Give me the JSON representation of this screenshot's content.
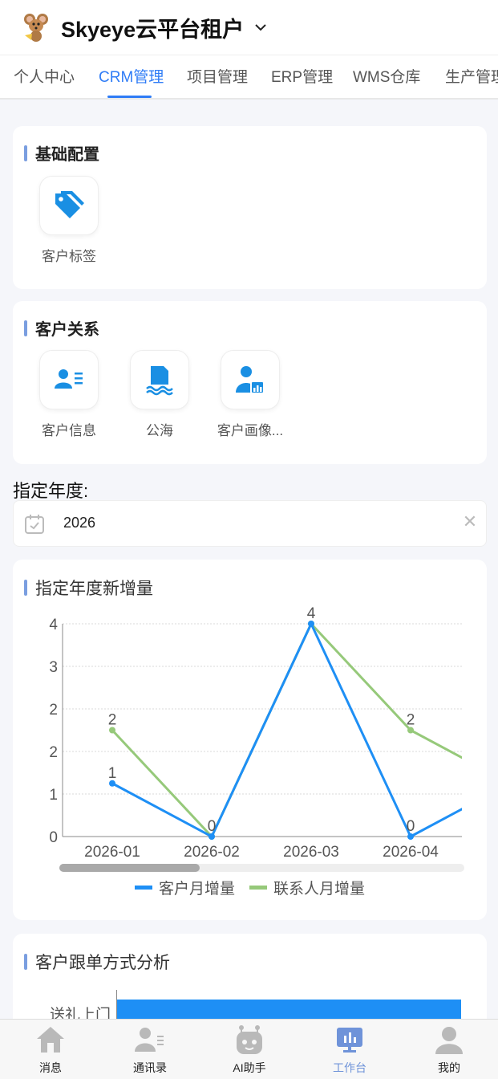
{
  "header": {
    "title": "Skyeye云平台租户"
  },
  "tabs": [
    "个人中心",
    "CRM管理",
    "项目管理",
    "ERP管理",
    "WMS仓库",
    "生产管理"
  ],
  "sections": {
    "basic": {
      "title": "基础配置",
      "items": [
        {
          "label": "客户标签",
          "icon": "tag-icon"
        }
      ]
    },
    "relations": {
      "title": "客户关系",
      "items": [
        {
          "label": "客户信息",
          "icon": "contact-card-icon"
        },
        {
          "label": "公海",
          "icon": "sea-document-icon"
        },
        {
          "label": "客户画像...",
          "icon": "user-chart-icon"
        }
      ]
    }
  },
  "year_filter": {
    "label": "指定年度:",
    "value": "2026"
  },
  "chart_section": {
    "title": "指定年度新增量"
  },
  "chart_data": {
    "type": "line",
    "title": "指定年度新增量",
    "categories": [
      "2026-01",
      "2026-02",
      "2026-03",
      "2026-04"
    ],
    "y_tick_labels": [
      "0",
      "1",
      "2",
      "2",
      "3",
      "4"
    ],
    "ylim": [
      0,
      4
    ],
    "series": [
      {
        "name": "客户月增量",
        "color": "#1e8ff5",
        "values": [
          1,
          0,
          4,
          0,
          1
        ],
        "labels": [
          "1",
          "0",
          "",
          "0",
          ""
        ]
      },
      {
        "name": "联系人月增量",
        "color": "#96c97a",
        "values": [
          2,
          0,
          4,
          2,
          1
        ],
        "labels": [
          "2",
          "",
          "4",
          "2",
          ""
        ]
      }
    ],
    "grid": true,
    "legend": "bottom"
  },
  "follow_section": {
    "title": "客户跟单方式分析",
    "chart_data": {
      "type": "bar",
      "categories": [
        "送礼上门"
      ],
      "color": "#1e8ff5"
    }
  },
  "bottom_nav": [
    {
      "label": "消息",
      "icon": "home-icon"
    },
    {
      "label": "通讯录",
      "icon": "contacts-icon"
    },
    {
      "label": "AI助手",
      "icon": "robot-icon"
    },
    {
      "label": "工作台",
      "icon": "dashboard-icon"
    },
    {
      "label": "我的",
      "icon": "user-icon"
    }
  ]
}
